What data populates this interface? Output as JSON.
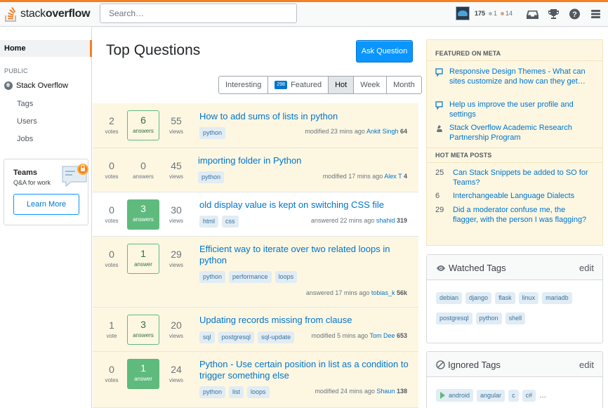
{
  "header": {
    "logo_text_light": "stack",
    "logo_text_bold": "overflow",
    "search_placeholder": "Search…",
    "reputation": "175",
    "silver_badges": "1",
    "bronze_badges": "14",
    "icons": [
      "inbox-icon",
      "achievements-icon",
      "help-icon",
      "site-switcher-icon"
    ]
  },
  "leftnav": {
    "home": "Home",
    "public_label": "PUBLIC",
    "items": [
      "Stack Overflow",
      "Tags",
      "Users",
      "Jobs"
    ],
    "teams": {
      "title": "Teams",
      "subtitle": "Q&A for work",
      "button": "Learn More"
    }
  },
  "main": {
    "title": "Top Questions",
    "ask_button": "Ask Question",
    "filters": [
      {
        "label": "Interesting"
      },
      {
        "label": "Featured",
        "count": "298"
      },
      {
        "label": "Hot",
        "active": true
      },
      {
        "label": "Week"
      },
      {
        "label": "Month"
      }
    ],
    "questions": [
      {
        "votes": "2",
        "votes_label": "votes",
        "answers": "6",
        "answers_label": "answers",
        "answer_state": "bordered",
        "views": "55",
        "views_label": "views",
        "title": "How to add sums of lists in python",
        "tags": [
          "python"
        ],
        "action": "modified",
        "time": "23 mins ago",
        "user": "Ankit Singh",
        "rep": "64"
      },
      {
        "votes": "0",
        "votes_label": "votes",
        "answers": "0",
        "answers_label": "answers",
        "answer_state": "none",
        "views": "45",
        "views_label": "views",
        "title": "importing folder in Python",
        "tags": [
          "python"
        ],
        "action": "modified",
        "time": "17 mins ago",
        "user": "Alex T",
        "rep": "4"
      },
      {
        "votes": "0",
        "votes_label": "votes",
        "answers": "3",
        "answers_label": "answers",
        "answer_state": "accepted",
        "views": "30",
        "views_label": "views",
        "title": "old display value is kept on switching CSS file",
        "tags": [
          "html",
          "css"
        ],
        "action": "answered",
        "time": "22 mins ago",
        "user": "shahid",
        "rep": "319"
      },
      {
        "votes": "0",
        "votes_label": "votes",
        "answers": "1",
        "answers_label": "answer",
        "answer_state": "bordered",
        "views": "29",
        "views_label": "views",
        "title": "Efficient way to iterate over two related loops in python",
        "tags": [
          "python",
          "performance",
          "loops"
        ],
        "action": "answered",
        "time": "17 mins ago",
        "user": "tobias_k",
        "rep": "56k"
      },
      {
        "votes": "1",
        "votes_label": "vote",
        "answers": "3",
        "answers_label": "answers",
        "answer_state": "bordered",
        "views": "20",
        "views_label": "views",
        "title": "Updating records missing from clause",
        "tags": [
          "sql",
          "postgresql",
          "sql-update"
        ],
        "action": "modified",
        "time": "5 mins ago",
        "user": "Tom Dee",
        "rep": "653"
      },
      {
        "votes": "0",
        "votes_label": "votes",
        "answers": "1",
        "answers_label": "answer",
        "answer_state": "accepted",
        "views": "24",
        "views_label": "views",
        "title": "Python - Use certain position in list as a condition to trigger something else",
        "tags": [
          "python",
          "list",
          "loops"
        ],
        "action": "modified",
        "time": "24 mins ago",
        "user": "Shaun",
        "rep": "138"
      }
    ]
  },
  "sidebar": {
    "featured_heading": "FEATURED ON META",
    "featured": [
      {
        "icon": "chat-bubble-icon",
        "text": "Responsive Design Themes - What can sites customize and how can they get…"
      },
      {
        "icon": "chat-bubble-icon",
        "text": "Help us improve the user profile and settings"
      },
      {
        "icon": "stack-exchange-icon",
        "text": "Stack Overflow Academic Research Partnership Program"
      }
    ],
    "hot_heading": "HOT META POSTS",
    "hot": [
      {
        "count": "25",
        "text": "Can Stack Snippets be added to SO for Teams?"
      },
      {
        "count": "6",
        "text": "Interchangeable Language Dialects"
      },
      {
        "count": "29",
        "text": "Did a moderator confuse me, the flagger, with the person I was flagging?"
      }
    ],
    "watched": {
      "title": "Watched Tags",
      "edit": "edit",
      "tags": [
        "debian",
        "django",
        "flask",
        "linux",
        "mariadb",
        "postgresql",
        "python",
        "shell"
      ]
    },
    "ignored": {
      "title": "Ignored Tags",
      "edit": "edit",
      "tags": [
        "android",
        "angular",
        "c",
        "c#"
      ],
      "more": "…"
    }
  },
  "colors": {
    "accent": "#f48024",
    "link": "#0074cc",
    "button": "#0a95ff",
    "accepted": "#5eba7d",
    "featured_bg": "#fdf7e2",
    "tag_bg": "#e1ecf4"
  }
}
